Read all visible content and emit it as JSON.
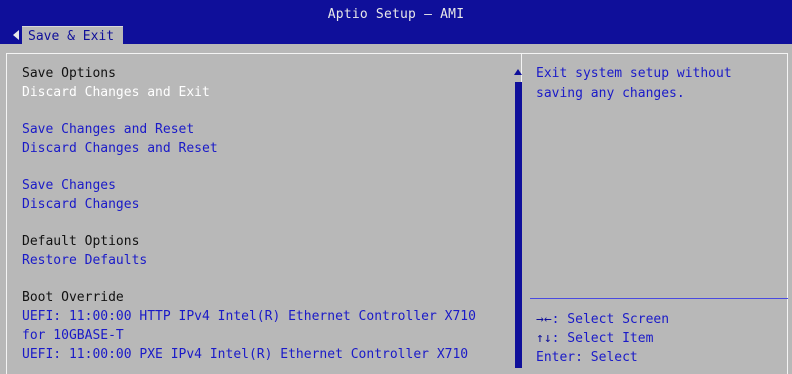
{
  "header": {
    "title": "Aptio Setup – AMI",
    "tab_label": "Save & Exit"
  },
  "menu": {
    "save_options_heading": "Save Options",
    "discard_changes_and_exit": "Discard Changes and Exit",
    "save_changes_and_reset": "Save Changes and Reset",
    "discard_changes_and_reset": "Discard Changes and Reset",
    "save_changes": "Save Changes",
    "discard_changes": "Discard Changes",
    "default_options_heading": "Default Options",
    "restore_defaults": "Restore Defaults",
    "boot_override_heading": "Boot Override",
    "boot_http_line1": "UEFI: 11:00:00 HTTP IPv4 Intel(R) Ethernet Controller X710",
    "boot_http_line2": "for 10GBASE-T",
    "boot_pxe_line1": "UEFI: 11:00:00 PXE IPv4 Intel(R) Ethernet Controller X710"
  },
  "help": {
    "line1": "Exit system setup without",
    "line2": "saving any changes."
  },
  "keys": {
    "select_screen_key": "→←",
    "select_screen_text": ": Select Screen",
    "select_item_key": "↑↓",
    "select_item_text": ": Select Item",
    "enter_text": "Enter: Select"
  }
}
